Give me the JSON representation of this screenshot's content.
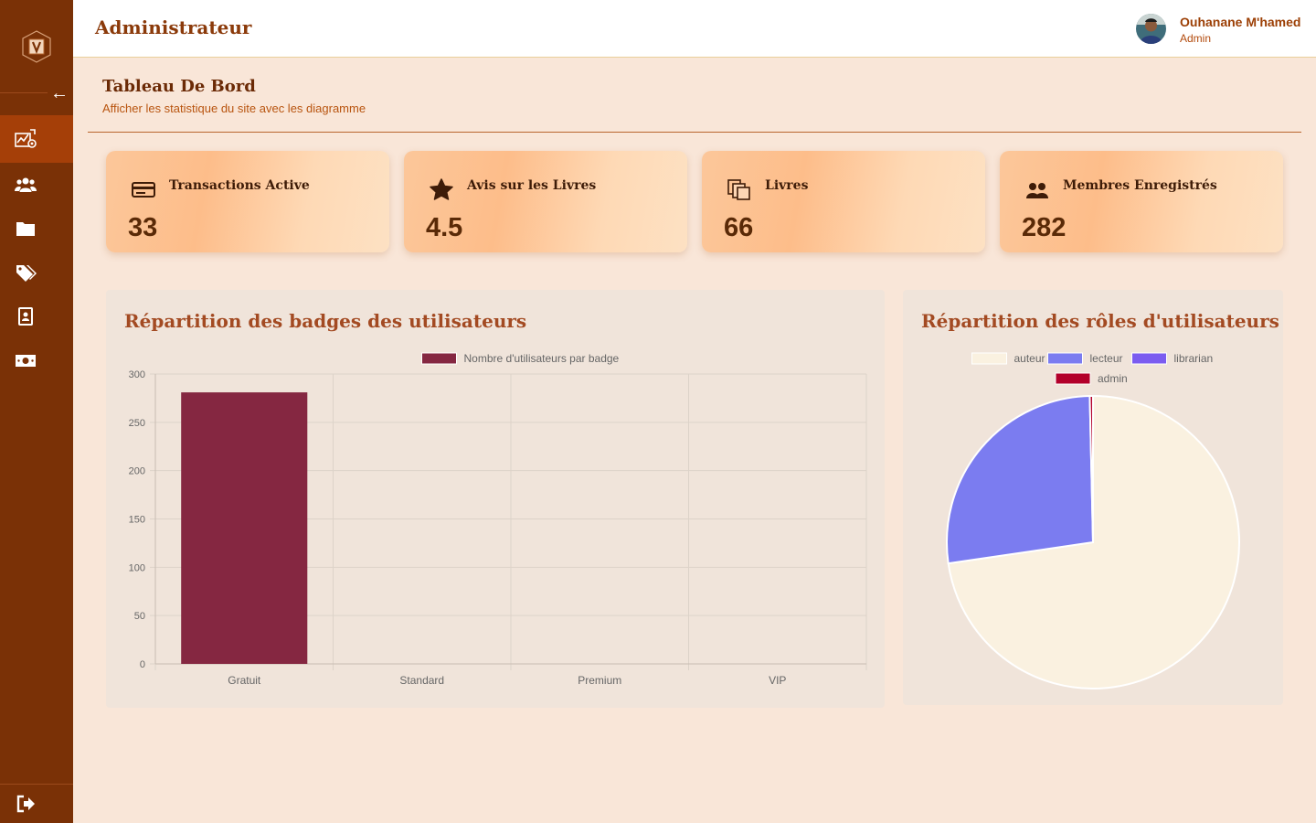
{
  "header": {
    "app_title": "Administrateur",
    "user_name": "Ouhanane M'hamed",
    "user_role": "Admin"
  },
  "page": {
    "title": "Tableau De Bord",
    "subtitle": "Afficher les statistique du site avec les diagramme"
  },
  "stats": [
    {
      "label": "Transactions Active",
      "value": "33",
      "icon": "credit-card-icon"
    },
    {
      "label": "Avis sur les Livres",
      "value": "4.5",
      "icon": "star-icon"
    },
    {
      "label": "Livres",
      "value": "66",
      "icon": "books-icon"
    },
    {
      "label": "Membres Enregistrés",
      "value": "282",
      "icon": "members-icon"
    }
  ],
  "sidebar": {
    "items": [
      {
        "icon": "dashboard-icon",
        "active": true
      },
      {
        "icon": "users-icon",
        "active": false
      },
      {
        "icon": "folder-icon",
        "active": false
      },
      {
        "icon": "tags-icon",
        "active": false
      },
      {
        "icon": "contact-card-icon",
        "active": false
      },
      {
        "icon": "money-icon",
        "active": false
      }
    ],
    "logout_icon": "logout-icon",
    "collapse_icon": "arrow-left-icon"
  },
  "colors": {
    "sidebar": "#7a3106",
    "sidebar_active": "#a53f08",
    "accent": "#8b3a0a",
    "bar": "#852741",
    "pie_auteur": "#faf1e0",
    "pie_lecteur": "#7b7cf0",
    "pie_librarian": "#7b5cf0",
    "pie_admin": "#b3002a"
  },
  "chart_data": [
    {
      "type": "bar",
      "title": "Répartition des badges des utilisateurs",
      "categories": [
        "Gratuit",
        "Standard",
        "Premium",
        "VIP"
      ],
      "series": [
        {
          "name": "Nombre d'utilisateurs par badge",
          "values": [
            281,
            0,
            0,
            0
          ]
        }
      ],
      "yticks": [
        "0",
        "50",
        "100",
        "150",
        "200",
        "250",
        "300"
      ],
      "ylim": [
        0,
        300
      ],
      "grid": true,
      "legend": "top"
    },
    {
      "type": "pie",
      "title": "Répartition des rôles d'utilisateurs",
      "labels": [
        "auteur",
        "lecteur",
        "librarian",
        "admin"
      ],
      "values": [
        205,
        76,
        0,
        1
      ],
      "legend": "top"
    }
  ]
}
